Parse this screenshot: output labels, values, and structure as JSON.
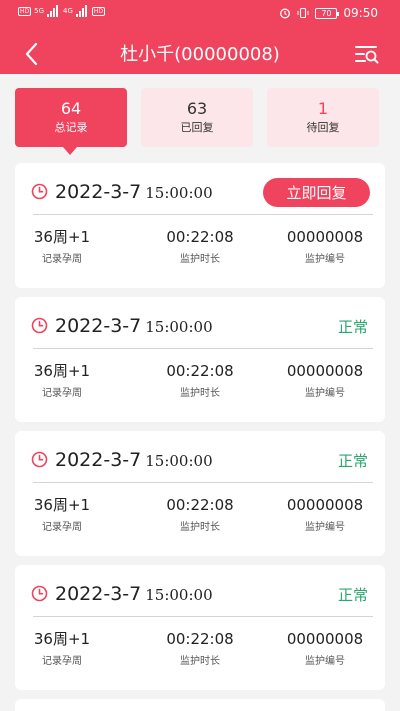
{
  "status_bar": {
    "time": "09:50",
    "battery": "70",
    "hd1": "HD",
    "hd2": "HD",
    "net1": "5G",
    "net2": "4G"
  },
  "header": {
    "title": "杜小千(00000008)"
  },
  "tabs": [
    {
      "count": "64",
      "label": "总记录"
    },
    {
      "count": "63",
      "label": "已回复"
    },
    {
      "count": "1",
      "label": "待回复"
    }
  ],
  "records": [
    {
      "date": "2022-3-7",
      "time": "15:00:00",
      "action_label": "立即回复",
      "week": "36周+1",
      "week_label": "记录孕周",
      "duration": "00:22:08",
      "duration_label": "监护时长",
      "id": "00000008",
      "id_label": "监护编号"
    },
    {
      "date": "2022-3-7",
      "time": "15:00:00",
      "status": "正常",
      "week": "36周+1",
      "week_label": "记录孕周",
      "duration": "00:22:08",
      "duration_label": "监护时长",
      "id": "00000008",
      "id_label": "监护编号"
    },
    {
      "date": "2022-3-7",
      "time": "15:00:00",
      "status": "正常",
      "week": "36周+1",
      "week_label": "记录孕周",
      "duration": "00:22:08",
      "duration_label": "监护时长",
      "id": "00000008",
      "id_label": "监护编号"
    },
    {
      "date": "2022-3-7",
      "time": "15:00:00",
      "status": "正常",
      "week": "36周+1",
      "week_label": "记录孕周",
      "duration": "00:22:08",
      "duration_label": "监护时长",
      "id": "00000008",
      "id_label": "监护编号"
    }
  ],
  "colors": {
    "accent": "#f0435d",
    "accent_light": "#fde6ea",
    "normal_status": "#2aa76f",
    "page_bg": "#f3f3f3"
  },
  "icons": {
    "back": "chevron-left-icon",
    "filter": "filter-list-icon",
    "record_time": "clock-icon"
  }
}
